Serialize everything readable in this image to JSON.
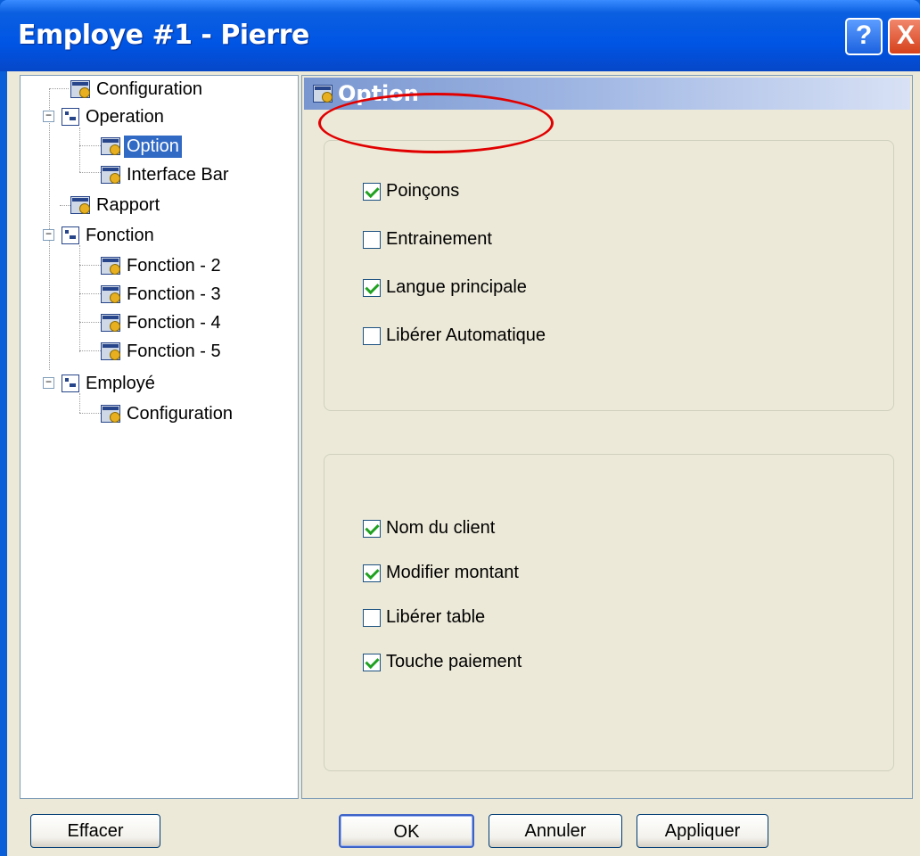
{
  "window": {
    "title": "Employe #1 - Pierre",
    "help_label": "?",
    "close_label": "X"
  },
  "tree": {
    "items": [
      {
        "label": "Configuration"
      },
      {
        "label": "Operation"
      },
      {
        "label": "Option"
      },
      {
        "label": "Interface Bar"
      },
      {
        "label": "Rapport"
      },
      {
        "label": "Fonction"
      },
      {
        "label": "Fonction - 2"
      },
      {
        "label": "Fonction - 3"
      },
      {
        "label": "Fonction - 4"
      },
      {
        "label": "Fonction - 5"
      },
      {
        "label": "Employé"
      },
      {
        "label": "Configuration"
      }
    ],
    "selected": "Option"
  },
  "panel": {
    "title": "Option",
    "group1": [
      {
        "label": "Poinçons",
        "checked": true
      },
      {
        "label": "Entrainement",
        "checked": false
      },
      {
        "label": "Langue principale",
        "checked": true
      },
      {
        "label": "Libérer Automatique",
        "checked": false
      }
    ],
    "group2": [
      {
        "label": "Nom du client",
        "checked": true
      },
      {
        "label": "Modifier montant",
        "checked": true
      },
      {
        "label": "Libérer table",
        "checked": false
      },
      {
        "label": "Touche paiement",
        "checked": true
      }
    ]
  },
  "buttons": {
    "effacer": "Effacer",
    "ok": "OK",
    "annuler": "Annuler",
    "appliquer": "Appliquer"
  },
  "colors": {
    "titlebar": "#0055e5",
    "selection": "#316ac5",
    "annotation_ring": "#e10000",
    "check": "#21a121"
  }
}
